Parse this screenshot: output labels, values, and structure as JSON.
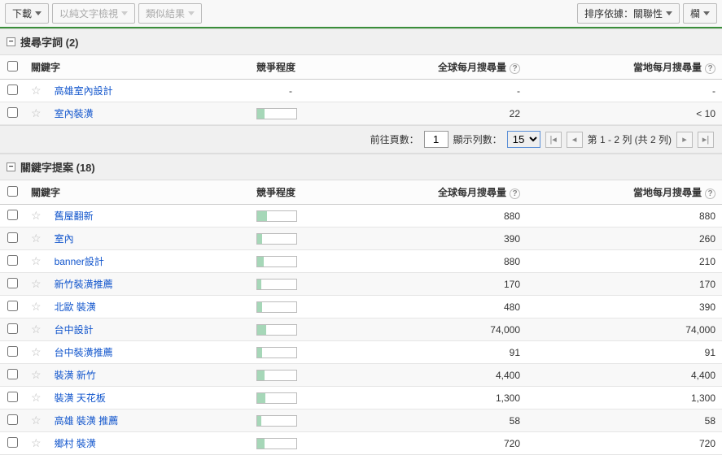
{
  "toolbar": {
    "download": "下載",
    "viewAsText": "以純文字檢視",
    "similarResults": "類似結果",
    "sortBy": "排序依據：關聯性",
    "columns": "欄"
  },
  "section1": {
    "title": "搜尋字詞 (2)"
  },
  "section2": {
    "title": "關鍵字提案 (18)"
  },
  "headers": {
    "keyword": "關鍵字",
    "competition": "競爭程度",
    "globalMonthly": "全球每月搜尋量",
    "localMonthly": "當地每月搜尋量"
  },
  "pager": {
    "gotoLabel": "前往頁數：",
    "gotoValue": "1",
    "rowsLabel": "顯示列數：",
    "rowsValue": "15",
    "rangeText": "第 1 - 2 列 (共 2 列)"
  },
  "searchTerms": [
    {
      "kw": "高雄室內設計",
      "comp": null,
      "global": "-",
      "local": "-"
    },
    {
      "kw": "室內裝潢",
      "comp": 18,
      "global": "22",
      "local": "< 10"
    }
  ],
  "ideas": [
    {
      "kw": "舊屋翻新",
      "comp": 25,
      "global": "880",
      "local": "880"
    },
    {
      "kw": "室內",
      "comp": 12,
      "global": "390",
      "local": "260"
    },
    {
      "kw": "banner設計",
      "comp": 16,
      "global": "880",
      "local": "210"
    },
    {
      "kw": "新竹裝潢推薦",
      "comp": 10,
      "global": "170",
      "local": "170"
    },
    {
      "kw": "北歐 裝潢",
      "comp": 12,
      "global": "480",
      "local": "390"
    },
    {
      "kw": "台中設計",
      "comp": 22,
      "global": "74,000",
      "local": "74,000"
    },
    {
      "kw": "台中裝潢推薦",
      "comp": 12,
      "global": "91",
      "local": "91"
    },
    {
      "kw": "裝潢 新竹",
      "comp": 18,
      "global": "4,400",
      "local": "4,400"
    },
    {
      "kw": "裝潢 天花板",
      "comp": 20,
      "global": "1,300",
      "local": "1,300"
    },
    {
      "kw": "高雄 裝潢 推薦",
      "comp": 10,
      "global": "58",
      "local": "58"
    },
    {
      "kw": "鄉村 裝潢",
      "comp": 18,
      "global": "720",
      "local": "720"
    }
  ]
}
